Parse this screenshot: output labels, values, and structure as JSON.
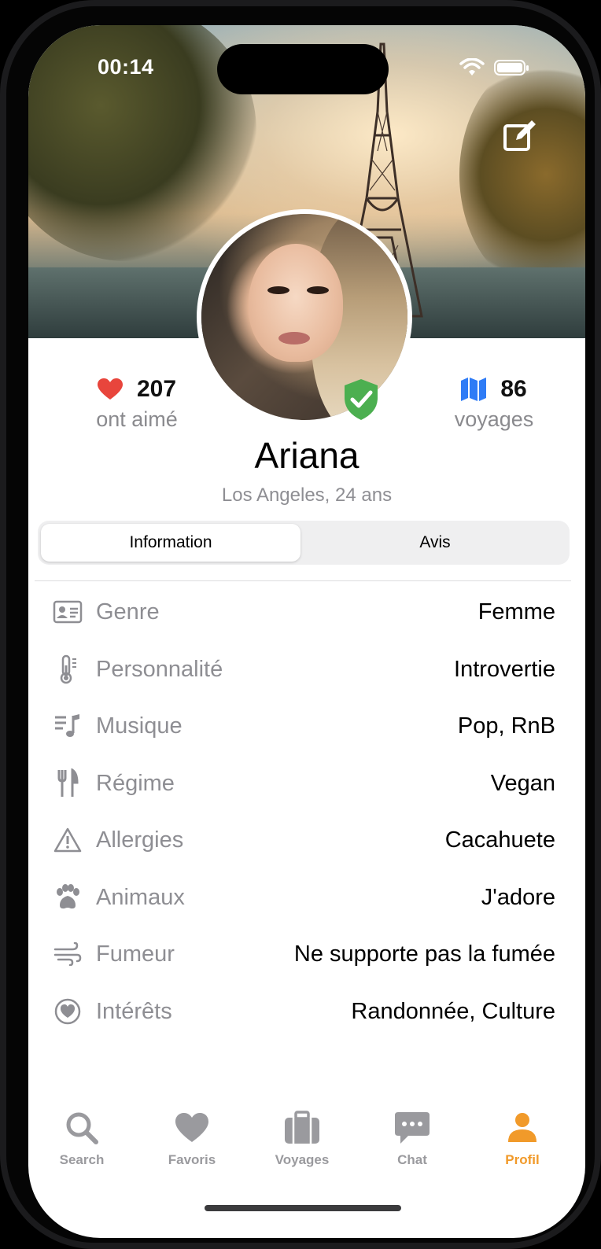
{
  "status_bar": {
    "time": "00:14"
  },
  "profile": {
    "name": "Ariana",
    "subtitle": "Los Angeles, 24 ans",
    "likes_count": "207",
    "likes_label": "ont aimé",
    "trips_count": "86",
    "trips_label": "voyages"
  },
  "segments": {
    "info": "Information",
    "reviews": "Avis",
    "selected": "Information"
  },
  "details": [
    {
      "label": "Genre",
      "value": "Femme",
      "icon": "id-card-icon"
    },
    {
      "label": "Personnalité",
      "value": "Introvertie",
      "icon": "thermometer-icon"
    },
    {
      "label": "Musique",
      "value": "Pop, RnB",
      "icon": "music-note-icon"
    },
    {
      "label": "Régime",
      "value": "Vegan",
      "icon": "fork-knife-icon"
    },
    {
      "label": "Allergies",
      "value": "Cacahuete",
      "icon": "warning-triangle-icon"
    },
    {
      "label": "Animaux",
      "value": "J'adore",
      "icon": "paw-icon"
    },
    {
      "label": "Fumeur",
      "value": "Ne supporte pas la fumée",
      "icon": "wind-icon"
    },
    {
      "label": "Intérêts",
      "value": "Randonnée, Culture",
      "icon": "heart-circle-icon"
    }
  ],
  "tabs": [
    {
      "label": "Search",
      "icon": "search-icon"
    },
    {
      "label": "Favoris",
      "icon": "heart-icon"
    },
    {
      "label": "Voyages",
      "icon": "suitcase-icon"
    },
    {
      "label": "Chat",
      "icon": "chat-bubble-icon"
    },
    {
      "label": "Profil",
      "icon": "person-icon",
      "active": true
    }
  ],
  "colors": {
    "accent": "#f19a2a",
    "like": "#e8453c",
    "trips": "#2f7cf6",
    "verified": "#4caf50"
  }
}
